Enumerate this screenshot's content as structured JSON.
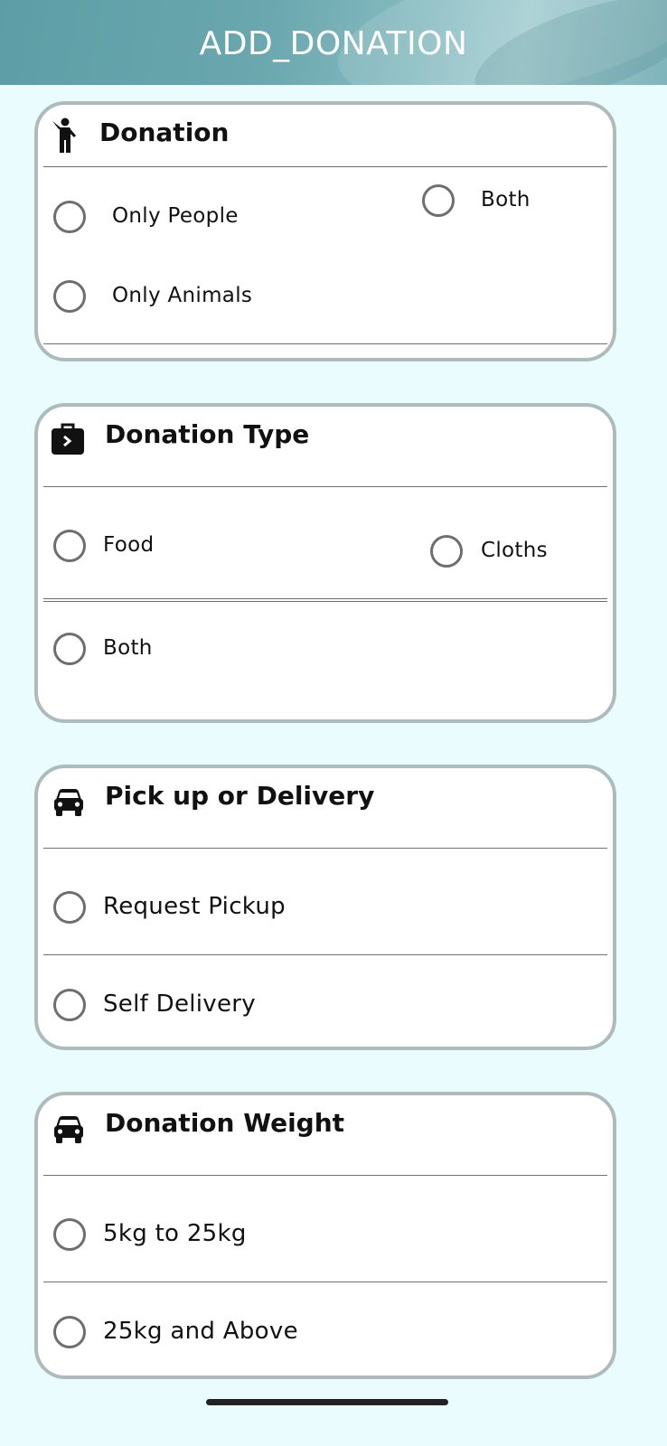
{
  "app_bar": {
    "title": "ADD_DONATION",
    "colors": {
      "start": "#5d9ea6",
      "end": "#a4cdd2"
    }
  },
  "background_color": "#eafcfd",
  "sections": {
    "donation": {
      "title": "Donation",
      "icon": "person-walking-icon",
      "options": {
        "only_people": "Only People",
        "both": "Both",
        "only_animals": "Only Animals"
      }
    },
    "donation_type": {
      "title": "Donation Type",
      "icon": "briefcase-icon",
      "options": {
        "food": "Food",
        "cloths": "Cloths",
        "both": "Both"
      }
    },
    "pickup": {
      "title": "Pick up or Delivery",
      "icon": "car-icon",
      "options": {
        "request_pickup": "Request Pickup",
        "self_delivery": "Self Delivery"
      }
    },
    "weight": {
      "title": "Donation Weight",
      "icon": "car-icon",
      "options": {
        "small": "5kg to 25kg",
        "large": "25kg and Above"
      }
    }
  }
}
